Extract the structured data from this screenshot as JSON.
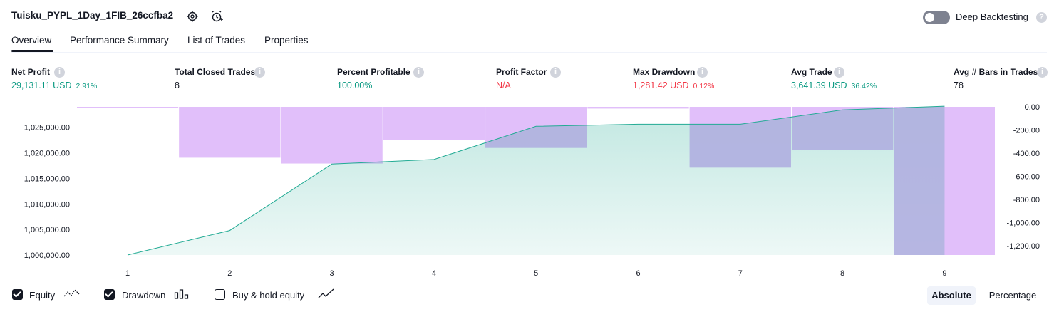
{
  "header": {
    "title": "Tuisku_PYPL_1Day_1FIB_26ccfba2",
    "deep_backtesting_label": "Deep Backtesting",
    "deep_backtesting_enabled": false,
    "help_icon": "question-icon",
    "settings_icon": "gear-icon",
    "add_alert_icon": "alarm-plus-icon"
  },
  "tabs": [
    {
      "label": "Overview",
      "active": true
    },
    {
      "label": "Performance Summary",
      "active": false
    },
    {
      "label": "List of Trades",
      "active": false
    },
    {
      "label": "Properties",
      "active": false
    }
  ],
  "metrics": [
    {
      "label": "Net Profit",
      "value": "29,131.11 USD",
      "pct": "2.91%",
      "tone": "green"
    },
    {
      "label": "Total Closed Trades",
      "value": "8",
      "pct": "",
      "tone": "neutral"
    },
    {
      "label": "Percent Profitable",
      "value": "100.00%",
      "pct": "",
      "tone": "green"
    },
    {
      "label": "Profit Factor",
      "value": "N/A",
      "pct": "",
      "tone": "red"
    },
    {
      "label": "Max Drawdown",
      "value": "1,281.42 USD",
      "pct": "0.12%",
      "tone": "red"
    },
    {
      "label": "Avg Trade",
      "value": "3,641.39 USD",
      "pct": "36.42%",
      "tone": "green"
    },
    {
      "label": "Avg # Bars in Trades",
      "value": "78",
      "pct": "",
      "tone": "neutral"
    }
  ],
  "chart_data": {
    "type": "line",
    "x": [
      1,
      2,
      3,
      4,
      5,
      6,
      7,
      8,
      9
    ],
    "y_left_ticks": [
      "1,000,000.00",
      "1,005,000.00",
      "1,010,000.00",
      "1,015,000.00",
      "1,020,000.00",
      "1,025,000.00"
    ],
    "y_left_ylim": [
      1000000,
      1029000
    ],
    "y_right_ticks": [
      "0.00",
      "-200.00",
      "-400.00",
      "-600.00",
      "-800.00",
      "-1,000.00",
      "-1,200.00"
    ],
    "y_right_ylim": [
      -1281.42,
      0
    ],
    "series": [
      {
        "name": "Equity",
        "axis": "left",
        "values": [
          1000000,
          1004800,
          1017800,
          1018700,
          1025200,
          1025600,
          1025600,
          1028400,
          1029131.11
        ]
      },
      {
        "name": "Drawdown",
        "axis": "right",
        "type": "bar",
        "values": [
          -5,
          -440,
          -490,
          -285,
          -355,
          -15,
          -525,
          -375,
          -1281.42
        ]
      },
      {
        "name": "Buy & hold equity",
        "axis": "left",
        "visible": false,
        "values": []
      }
    ],
    "colors": {
      "equity_line": "#22ab94",
      "equity_fill": "#22ab94",
      "drawdown_bar": "#e1bffa",
      "overlap": "#b2b5e0"
    }
  },
  "legend": [
    {
      "label": "Equity",
      "checked": true,
      "icon": "equity-line-icon"
    },
    {
      "label": "Drawdown",
      "checked": true,
      "icon": "drawdown-bars-icon"
    },
    {
      "label": "Buy & hold equity",
      "checked": false,
      "icon": "buy-hold-line-icon"
    }
  ],
  "view_mode": {
    "absolute_label": "Absolute",
    "percentage_label": "Percentage",
    "selected": "Absolute"
  }
}
